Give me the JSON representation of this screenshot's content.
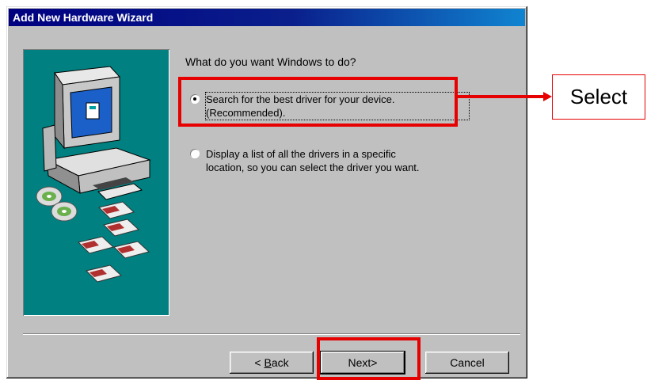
{
  "window": {
    "title": "Add New Hardware Wizard"
  },
  "prompt": "What do you want Windows to do?",
  "options": [
    {
      "label_line1": "Search for the best driver for your device.",
      "label_line2": "(Recommended).",
      "selected": true
    },
    {
      "label_line1": "Display a list of all the drivers in a specific",
      "label_line2": "location, so you can select the driver you want.",
      "selected": false
    }
  ],
  "buttons": {
    "back_prefix": "< ",
    "back_mnemonic": "B",
    "back_rest": "ack",
    "next": "Next>",
    "cancel": "Cancel"
  },
  "annotation": {
    "callout": "Select",
    "color": "#e60000"
  },
  "illustration": {
    "icons": [
      "computer-icon",
      "cd-rom-discs-icon",
      "floppy-disks-icon"
    ],
    "background": "#008080"
  }
}
